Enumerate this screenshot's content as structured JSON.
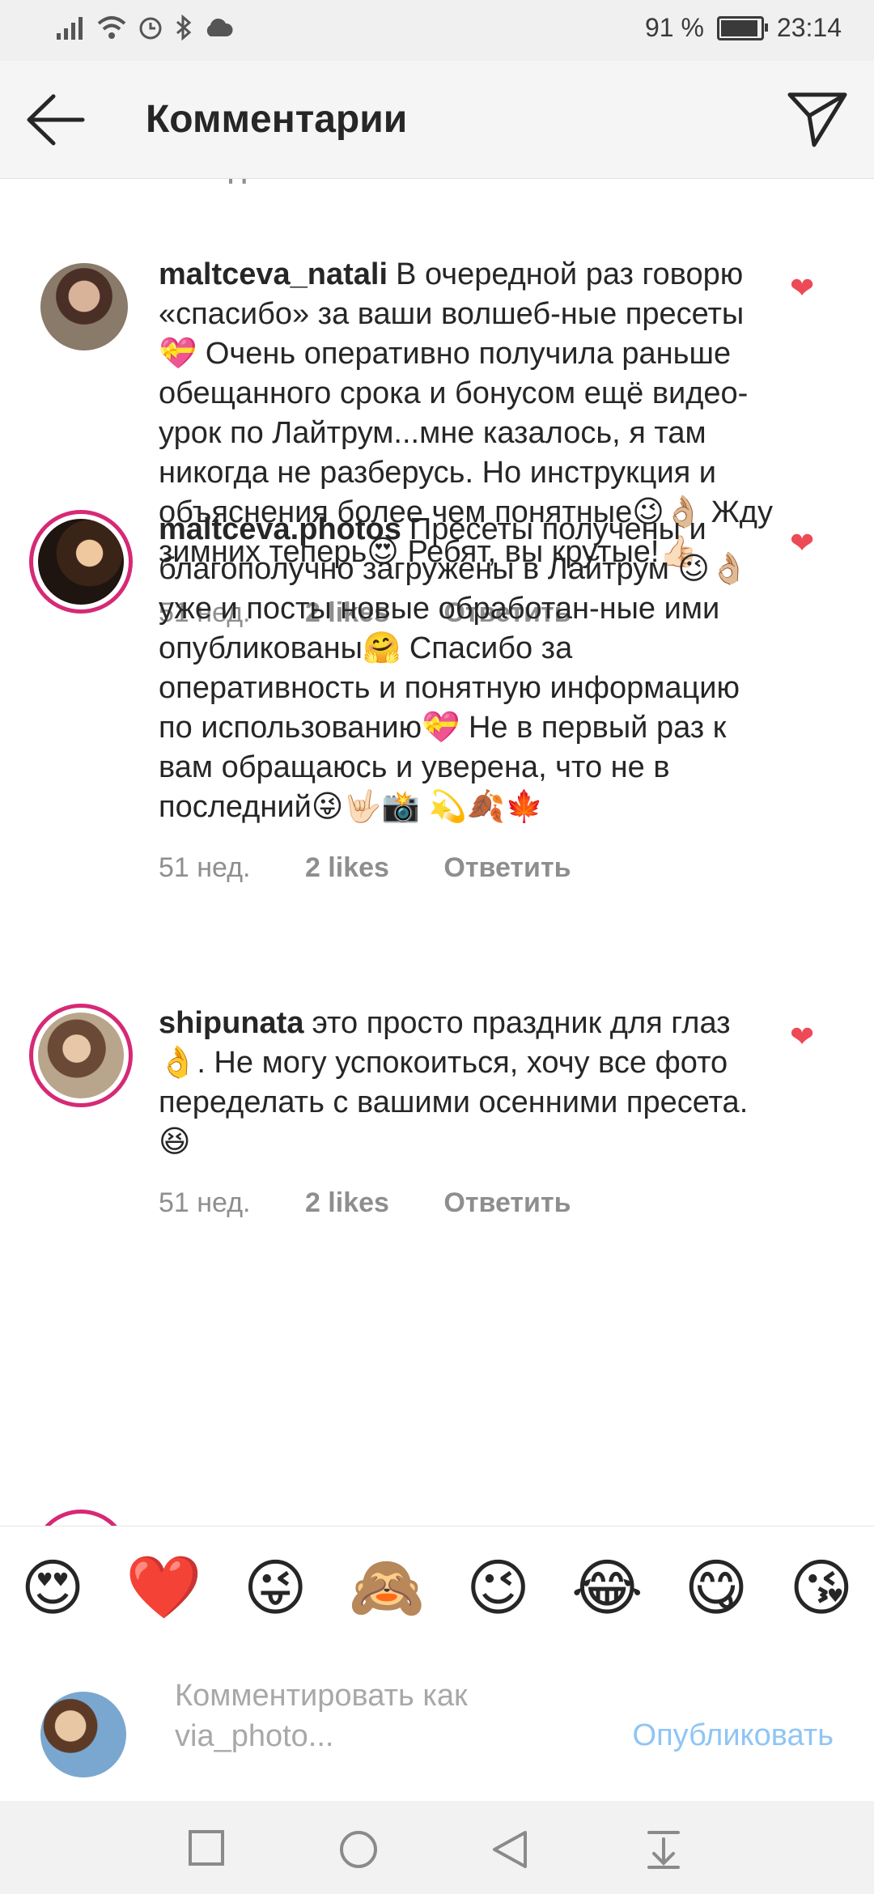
{
  "status_bar": {
    "battery": "91 %",
    "time": "23:14",
    "battery_level": 0.91
  },
  "header": {
    "title": "Комментарии",
    "back_icon": "arrow-left-icon",
    "send_icon": "send-icon"
  },
  "partial_meta": {
    "time": "51 нед.",
    "likes": "1 like",
    "reply": "Ответить"
  },
  "comments": [
    {
      "username": "maltceva_natali",
      "text": "В очередной раз говорю «спасибо» за ваши волшеб-ные пресеты💝 Очень оперативно получила раньше обещанного срока и бонусом ещё видео-урок по Лайтрум...мне казалось, я там никогда не разберусь. Но инструкция и объяснения более чем понятные😉👌🏼 Жду зимних теперь😍 Ребят, вы крутые!👍🏻",
      "time": "51 нед.",
      "likes": "2 likes",
      "reply": "Ответить",
      "liked": true
    },
    {
      "username": "maltceva.photos",
      "text": "Пресеты получены и благополучно загружены в Лайтрум 😉👌🏼 уже и посты новые обработан-ные ими опубликованы🤗 Спасибо за оперативность и понятную информацию по использованию💝 Не в первый раз к вам обращаюсь и уверена, что не в последний😜🤟🏻📸 💫🍂🍁",
      "time": "51 нед.",
      "likes": "2 likes",
      "reply": "Ответить",
      "liked": true
    },
    {
      "username": "shipunata",
      "text": "это просто праздник для глаз 👌. Не могу успокоиться, хочу все фото переделать с вашими осенними пресета. 😆",
      "time": "51 нед.",
      "likes": "2 likes",
      "reply": "Ответить",
      "liked": true
    }
  ],
  "emojis": [
    "😍",
    "❤️",
    "😜",
    "🙈",
    "😉",
    "😂",
    "😋",
    "😘"
  ],
  "composer": {
    "placeholder": "Комментировать как via_photo...",
    "publish": "Опубликовать"
  },
  "nav": {
    "recents_icon": "square-icon",
    "home_icon": "circle-icon",
    "back_icon": "triangle-back-icon",
    "notifications_icon": "pull-down-icon"
  },
  "colors": {
    "heart": "#ed4956",
    "ring": "#d62976",
    "publish": "#8fc5f5",
    "meta": "#8e8e8e"
  }
}
